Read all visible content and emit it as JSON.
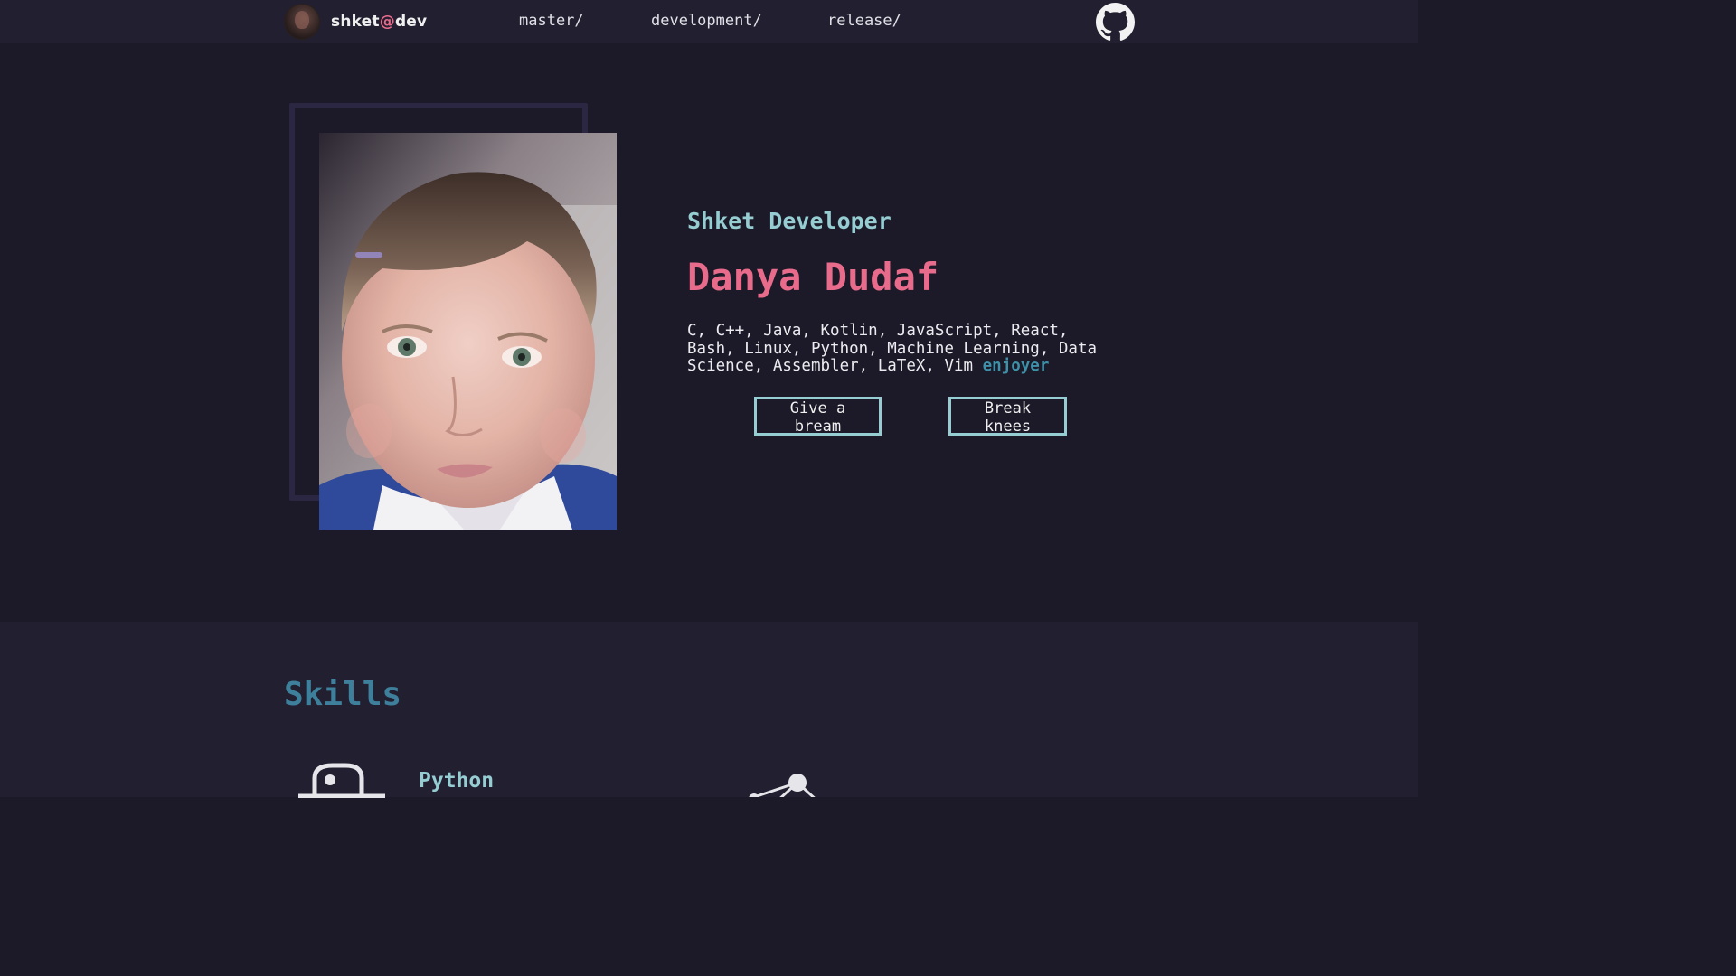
{
  "nav": {
    "brand_prefix": "shket",
    "brand_at": "@",
    "brand_suffix": "dev",
    "links": [
      {
        "label": "master/"
      },
      {
        "label": "development/"
      },
      {
        "label": "release/"
      }
    ],
    "github_icon": "github-icon"
  },
  "hero": {
    "subtitle": "Shket Developer",
    "name": "Danya Dudaf",
    "tech_list": "C, C++, Java, Kotlin, JavaScript, React, Bash, Linux, Python, Machine Learning, Data Science, Assembler, LaTeX, Vim",
    "tech_accent": "enjoyer",
    "buttons": [
      {
        "label": "Give a bream"
      },
      {
        "label": "Break knees"
      }
    ]
  },
  "skills": {
    "title": "Skills",
    "items": [
      {
        "name": "Python",
        "icon": "python-icon"
      },
      {
        "name": "",
        "icon": "network-graph-icon"
      }
    ]
  },
  "colors": {
    "background": "#1c1a28",
    "navbar": "#211f30",
    "accent_pink": "#e96b8c",
    "accent_cyan": "#95cdd2",
    "accent_teal": "#3e809b"
  }
}
